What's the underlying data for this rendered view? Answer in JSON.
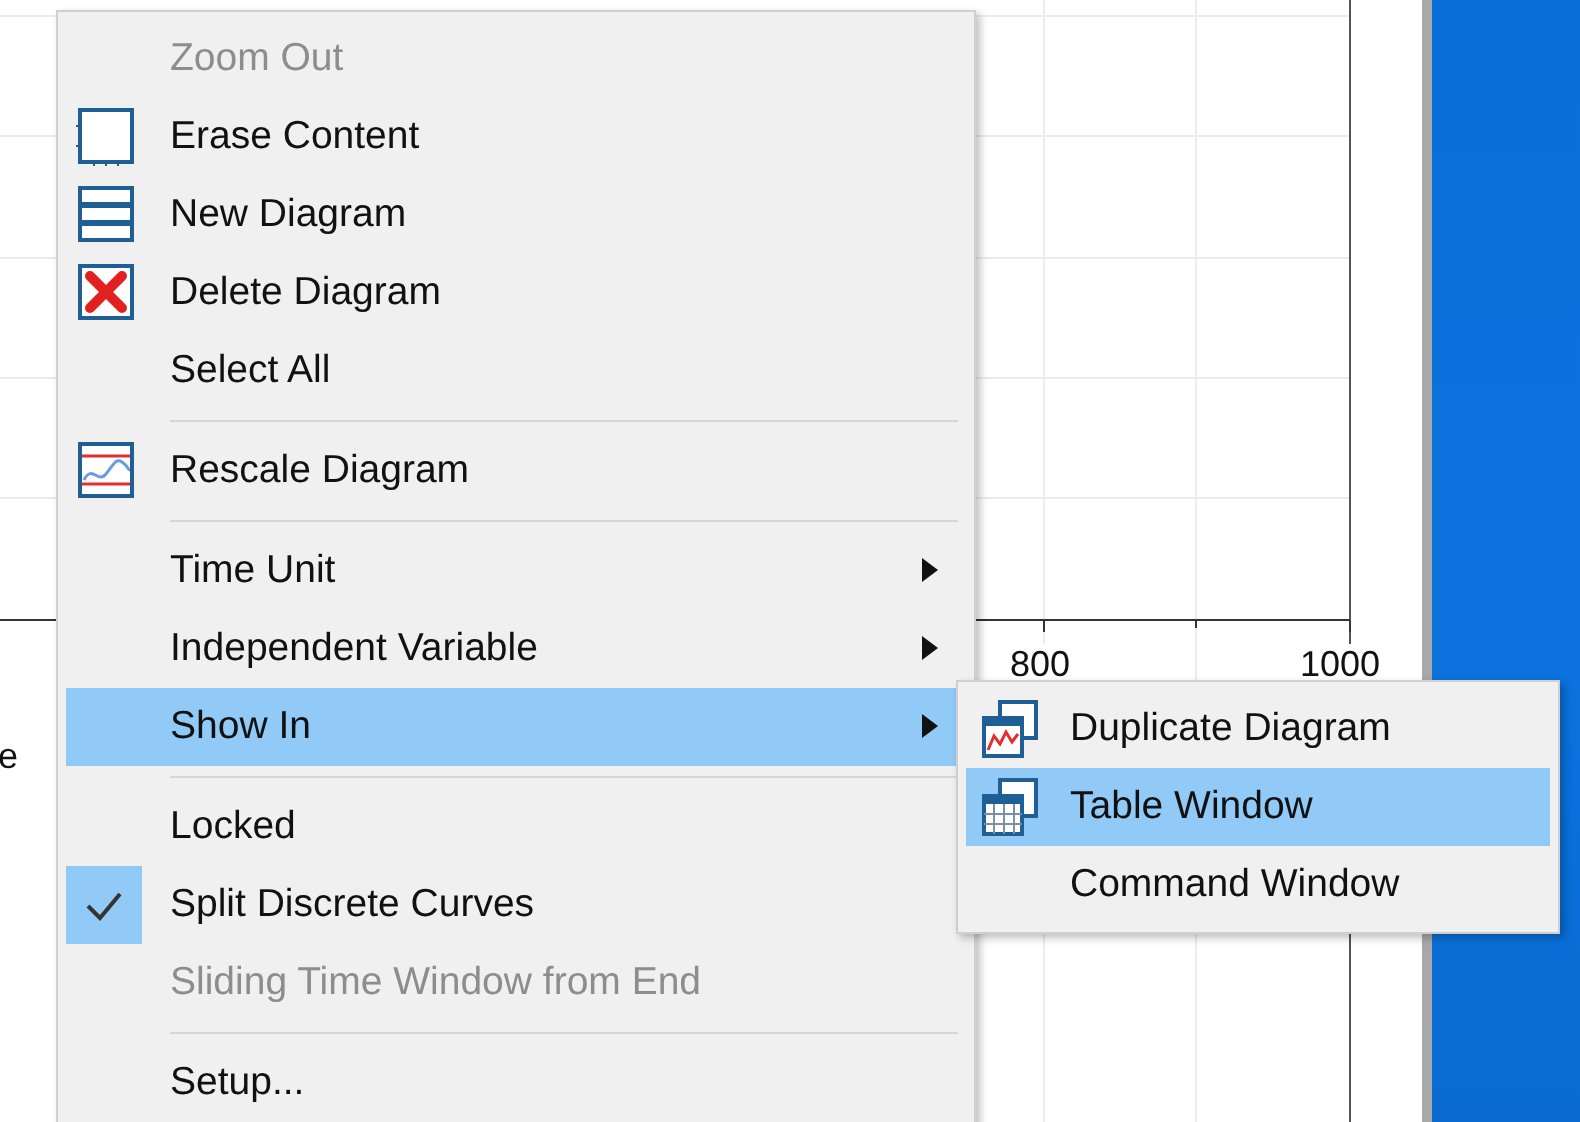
{
  "plot": {
    "x_tick_labels": [
      "800",
      "1000"
    ],
    "axis_label_fragment": "e"
  },
  "context_menu": {
    "items": [
      {
        "kind": "item",
        "label": "Zoom Out",
        "disabled": true,
        "selected": false
      },
      {
        "kind": "item",
        "label": "Erase Content",
        "disabled": false,
        "selected": false
      },
      {
        "kind": "item",
        "label": "New Diagram",
        "disabled": false,
        "selected": false
      },
      {
        "kind": "item",
        "label": "Delete Diagram",
        "disabled": false,
        "selected": false
      },
      {
        "kind": "item",
        "label": "Select All",
        "disabled": false,
        "selected": false
      },
      {
        "kind": "separator"
      },
      {
        "kind": "item",
        "label": "Rescale Diagram",
        "disabled": false,
        "selected": false
      },
      {
        "kind": "separator"
      },
      {
        "kind": "item",
        "label": "Time Unit",
        "submenu": true,
        "disabled": false,
        "selected": false
      },
      {
        "kind": "item",
        "label": "Independent Variable",
        "submenu": true,
        "disabled": false,
        "selected": false
      },
      {
        "kind": "item",
        "label": "Show In",
        "submenu": true,
        "disabled": false,
        "selected": true
      },
      {
        "kind": "separator"
      },
      {
        "kind": "item",
        "label": "Locked",
        "checked": false,
        "disabled": false,
        "selected": false
      },
      {
        "kind": "item",
        "label": "Split Discrete Curves",
        "checked": true,
        "disabled": false,
        "selected": false
      },
      {
        "kind": "item",
        "label": "Sliding Time Window from End",
        "checked": false,
        "disabled": true,
        "selected": false
      },
      {
        "kind": "separator"
      },
      {
        "kind": "item",
        "label": "Setup...",
        "disabled": false,
        "selected": false
      }
    ]
  },
  "submenu": {
    "items": [
      {
        "label": "Duplicate Diagram",
        "selected": false
      },
      {
        "label": "Table Window",
        "selected": true
      },
      {
        "label": "Command Window",
        "selected": false
      }
    ]
  }
}
